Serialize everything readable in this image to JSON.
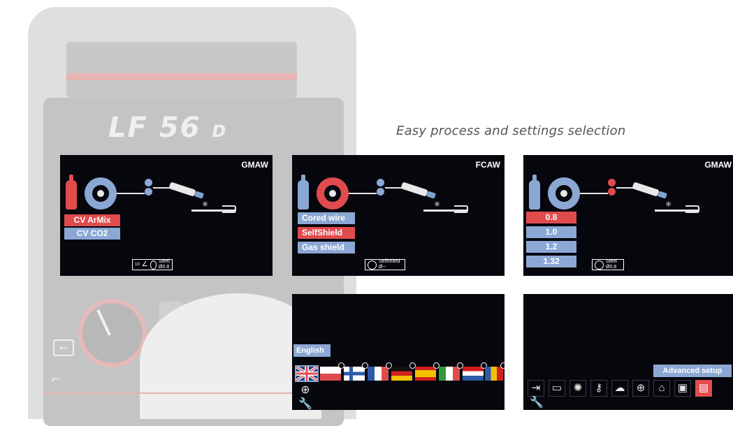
{
  "caption": "Easy process and settings selection",
  "brand": {
    "model": "LF 56",
    "suffix": "D"
  },
  "colors": {
    "highlight": "#e04b4e",
    "option": "#8ba7d4",
    "screen_bg": "#06060d"
  },
  "screen1": {
    "mode": "GMAW",
    "options": [
      "CV ArMix",
      "CV CO2"
    ],
    "selected_index": 0,
    "status": {
      "num": "10",
      "icons": [
        "torch-angle-icon",
        "wire-spool-icon"
      ],
      "text": "Steel\nØ0.8"
    }
  },
  "screen2": {
    "mode": "FCAW",
    "options": [
      "Cored wire",
      "SelfShield",
      "Gas shield"
    ],
    "selected_index": 1,
    "status": {
      "icons": [
        "wire-spool-icon"
      ],
      "text": "Selfshield\nØ--"
    }
  },
  "screen3": {
    "mode": "GMAW",
    "options": [
      "0.8",
      "1.0",
      "1.2",
      "1.32"
    ],
    "selected_index": 0,
    "status": {
      "icons": [
        "wire-spool-icon"
      ],
      "text": "Steel\nØ0.8"
    }
  },
  "screen4": {
    "language_label": "English",
    "flags": [
      "uk-flag-icon",
      "poland-flag-icon",
      "finland-flag-icon",
      "france-flag-icon",
      "germany-flag-icon",
      "spain-flag-icon",
      "italy-flag-icon",
      "netherlands-flag-icon",
      "romania-flag-icon"
    ],
    "selected_flag": 0,
    "row_icons": [
      "globe-icon",
      "wrench-icon"
    ]
  },
  "screen5": {
    "label": "Advanced setup",
    "icons": [
      "wire-feed-icon",
      "display-icon",
      "brightness-icon",
      "key-icon",
      "chat-icon",
      "globe-icon",
      "factory-icon",
      "memory-icon",
      "document-icon"
    ],
    "selected_index": 8,
    "row_icons": [
      "wrench-icon"
    ]
  }
}
